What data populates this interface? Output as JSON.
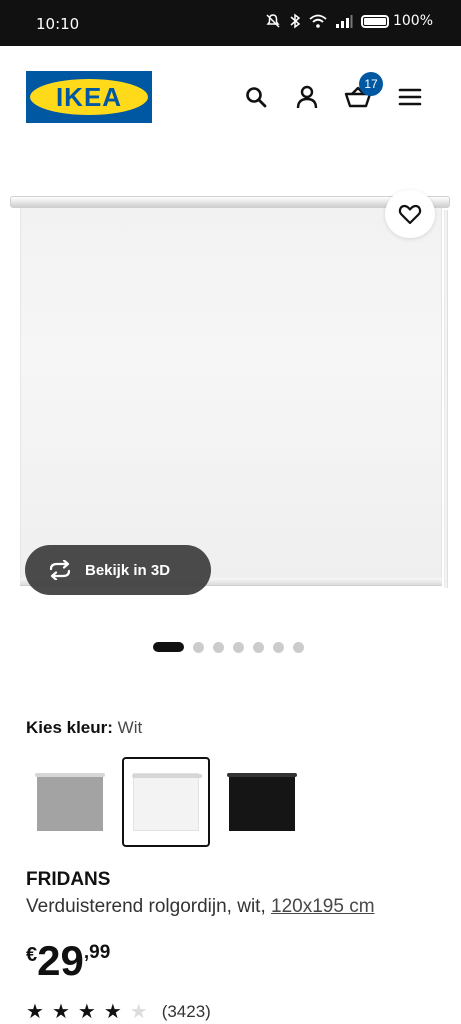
{
  "status_bar": {
    "time": "10:10",
    "battery": "100%"
  },
  "header": {
    "logo_text": "IKEA",
    "basket_count": "17",
    "colors": {
      "ikea_blue": "#0058a3",
      "ikea_yellow": "#ffda1a"
    }
  },
  "gallery": {
    "view_3d_label": "Bekijk in 3D",
    "dot_count": 7,
    "active_index": 0
  },
  "color_picker": {
    "label": "Kies kleur:",
    "selected": "Wit",
    "swatches": [
      {
        "name": "grijs",
        "color": "#a3a3a3",
        "selected": false
      },
      {
        "name": "wit",
        "color": "#f3f3f3",
        "selected": true
      },
      {
        "name": "zwart",
        "color": "#151515",
        "selected": false
      }
    ]
  },
  "product": {
    "name": "FRIDANS",
    "description": "Verduisterend rolgordijn, wit,",
    "size": "120x195 cm",
    "price": {
      "currency": "€",
      "integer": "29",
      "decimal": ",99"
    },
    "rating": {
      "stars_filled": 4,
      "stars_total": 5,
      "review_count": "(3423)"
    }
  }
}
